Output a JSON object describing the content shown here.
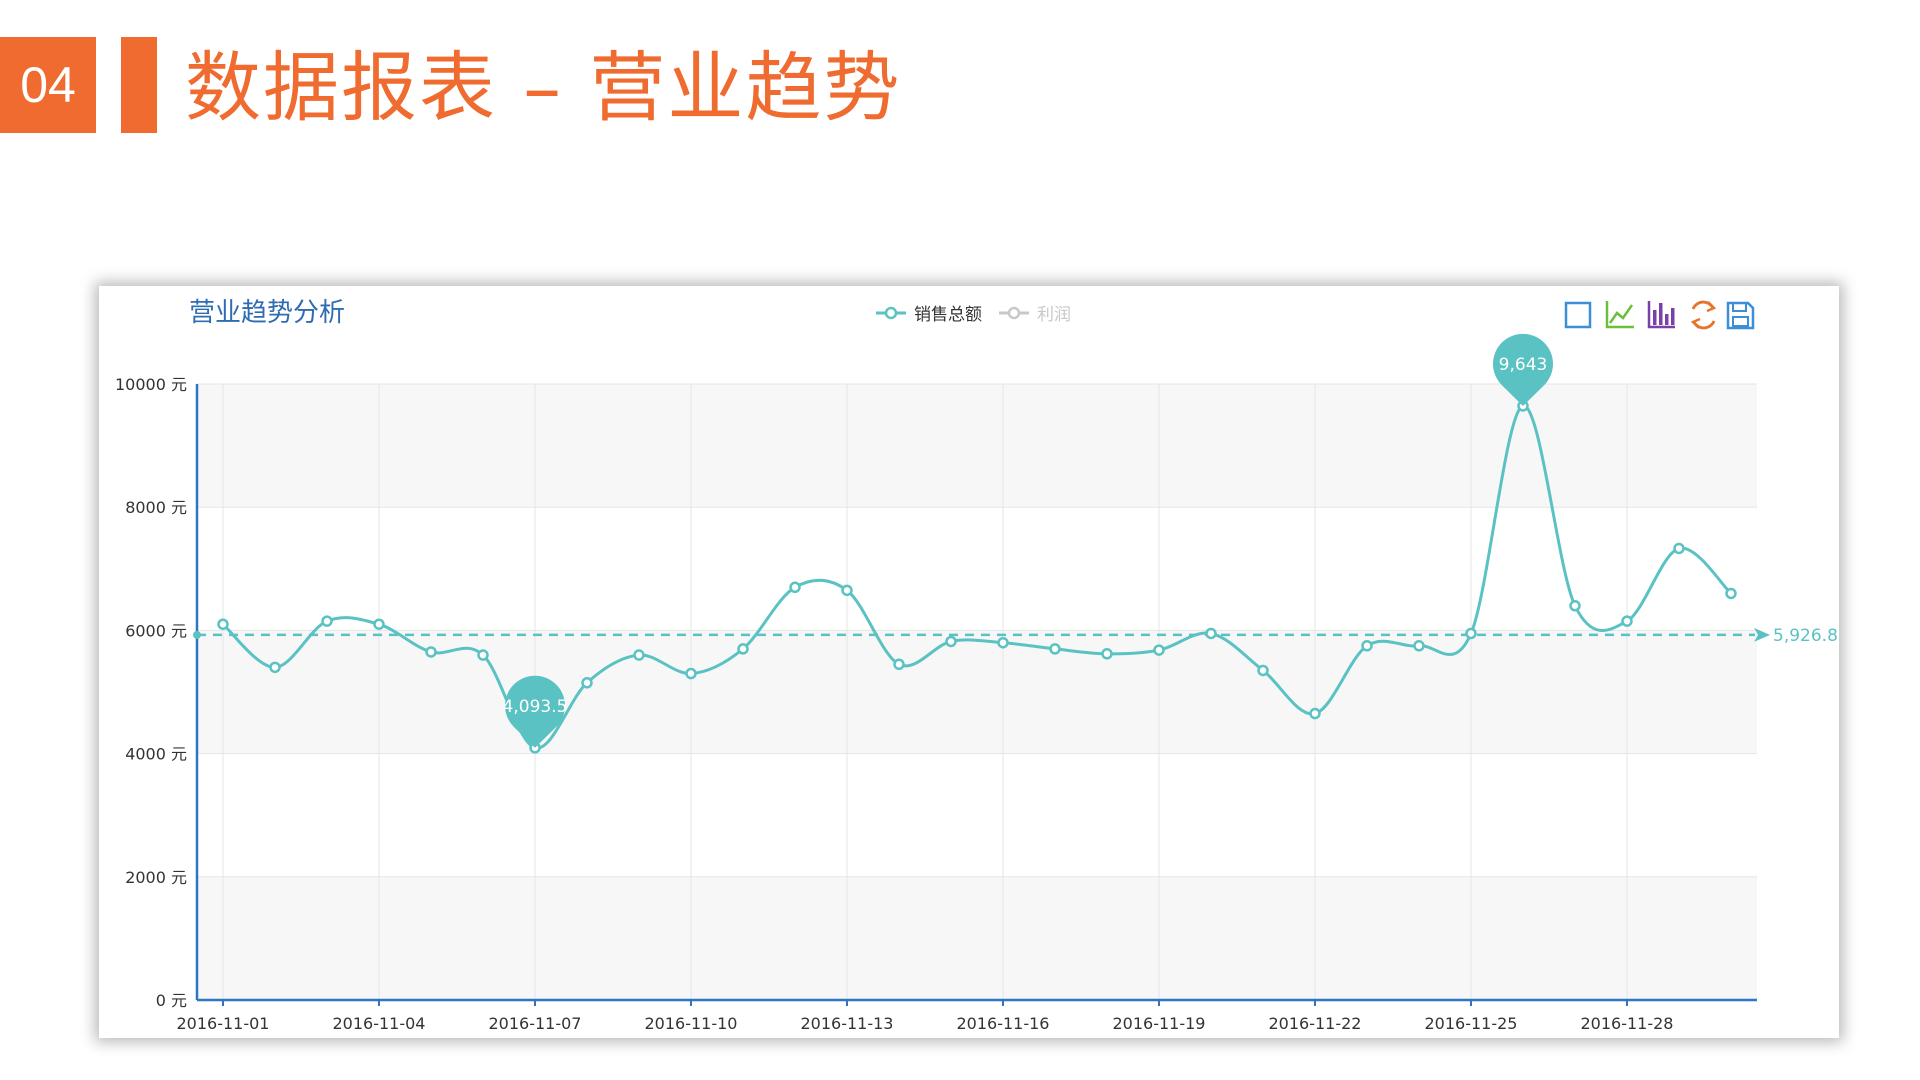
{
  "slide": {
    "number": "04",
    "title": "数据报表 – 营业趋势"
  },
  "colors": {
    "accent": "#ef6b2f",
    "series": "#5bc2c4",
    "series_inactive": "#c8c8c8",
    "axis": "#2d77c2",
    "title": "#2f6cb2"
  },
  "toolbox": {
    "icons": [
      "rect-select-icon",
      "line-chart-icon",
      "bar-chart-icon",
      "refresh-icon",
      "save-icon"
    ]
  },
  "chart_data": {
    "type": "line",
    "title": "营业趋势分析",
    "legend": [
      "销售总额",
      "利润"
    ],
    "legend_position": "top-center",
    "grid": true,
    "y_unit": "元",
    "ylim": [
      0,
      10000
    ],
    "yticks": [
      0,
      2000,
      4000,
      6000,
      8000,
      10000
    ],
    "xlim": [
      "2016-11-01",
      "2016-11-30"
    ],
    "xticks": [
      "2016-11-01",
      "2016-11-04",
      "2016-11-07",
      "2016-11-10",
      "2016-11-13",
      "2016-11-16",
      "2016-11-19",
      "2016-11-22",
      "2016-11-25",
      "2016-11-28"
    ],
    "series": [
      {
        "name": "销售总额",
        "smooth": true,
        "x": [
          "2016-11-01",
          "2016-11-02",
          "2016-11-03",
          "2016-11-04",
          "2016-11-05",
          "2016-11-06",
          "2016-11-07",
          "2016-11-08",
          "2016-11-09",
          "2016-11-10",
          "2016-11-11",
          "2016-11-12",
          "2016-11-13",
          "2016-11-14",
          "2016-11-15",
          "2016-11-16",
          "2016-11-17",
          "2016-11-18",
          "2016-11-19",
          "2016-11-20",
          "2016-11-21",
          "2016-11-22",
          "2016-11-23",
          "2016-11-24",
          "2016-11-25",
          "2016-11-26",
          "2016-11-27",
          "2016-11-28",
          "2016-11-29",
          "2016-11-30"
        ],
        "values": [
          6100,
          5400,
          6150,
          6100,
          5650,
          5600,
          4093.5,
          5150,
          5600,
          5300,
          5700,
          6700,
          6650,
          5450,
          5820,
          5800,
          5700,
          5620,
          5680,
          5950,
          5350,
          4650,
          5750,
          5750,
          5950,
          9643,
          6400,
          6150,
          7330,
          6600
        ]
      },
      {
        "name": "利润",
        "visible": false,
        "values": []
      }
    ],
    "mark_points": [
      {
        "label": "9,643",
        "x": "2016-11-26",
        "value": 9643
      },
      {
        "label": "4,093.5",
        "x": "2016-11-07",
        "value": 4093.5
      }
    ],
    "mark_line": {
      "label": "5,926.82",
      "value": 5926.82
    }
  }
}
